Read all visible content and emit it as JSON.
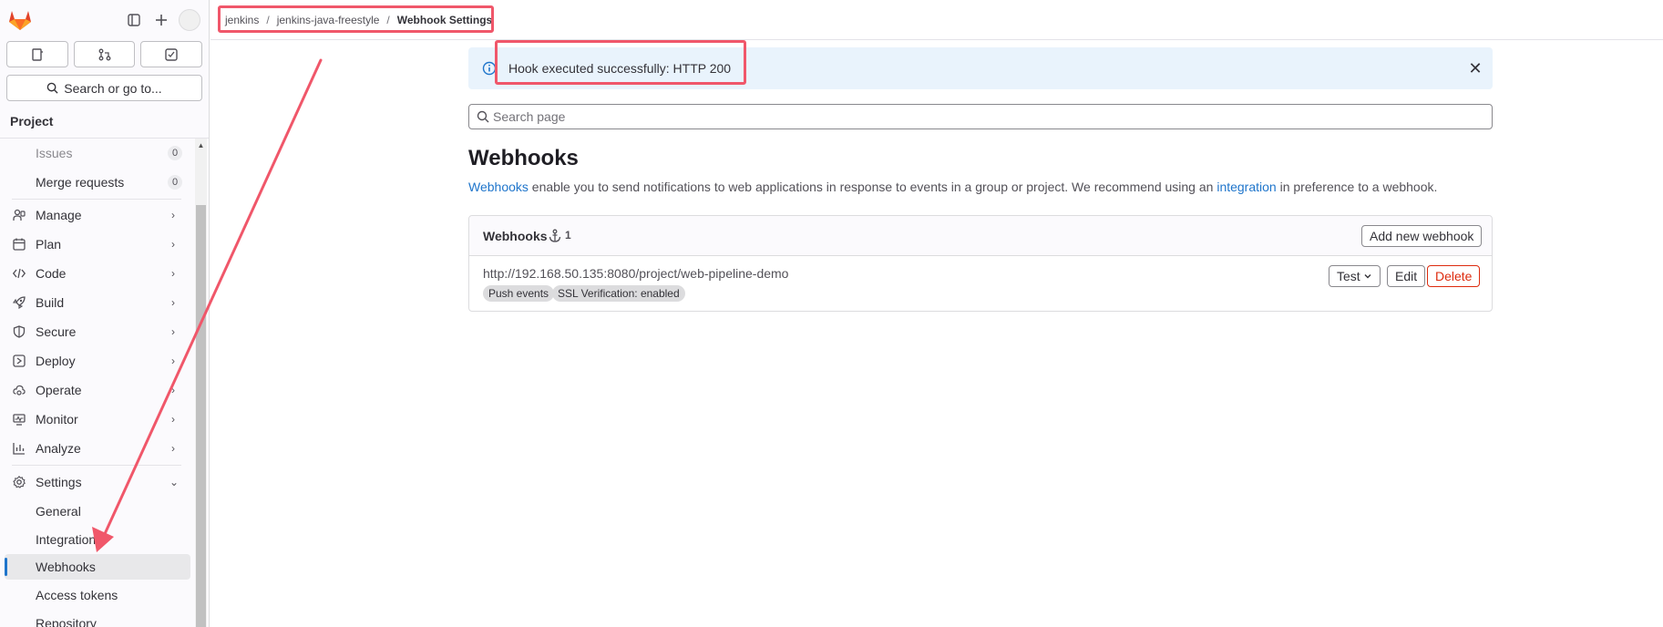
{
  "app": {
    "brand_color": "#fc6d26",
    "accent": "#1f75cb",
    "highlight": "#f0576a"
  },
  "sidebar": {
    "search_label": "Search or go to...",
    "section_title": "Project",
    "items": [
      {
        "label": "Issues",
        "badge": "0",
        "icon": "issues-icon"
      },
      {
        "label": "Merge requests",
        "badge": "0",
        "icon": "merge-request-icon"
      },
      {
        "label": "Manage",
        "icon": "users-icon"
      },
      {
        "label": "Plan",
        "icon": "calendar-icon"
      },
      {
        "label": "Code",
        "icon": "code-icon"
      },
      {
        "label": "Build",
        "icon": "rocket-icon"
      },
      {
        "label": "Secure",
        "icon": "shield-icon"
      },
      {
        "label": "Deploy",
        "icon": "deploy-icon"
      },
      {
        "label": "Operate",
        "icon": "cloud-gear-icon"
      },
      {
        "label": "Monitor",
        "icon": "monitor-icon"
      },
      {
        "label": "Analyze",
        "icon": "chart-icon"
      },
      {
        "label": "Settings",
        "icon": "gear-icon"
      }
    ],
    "settings_sub": [
      "General",
      "Integrations",
      "Webhooks",
      "Access tokens",
      "Repository"
    ]
  },
  "breadcrumb": {
    "items": [
      "jenkins",
      "jenkins-java-freestyle"
    ],
    "current": "Webhook Settings",
    "separator": "/"
  },
  "alert": {
    "message": "Hook executed successfully: HTTP 200",
    "close": "✕"
  },
  "search": {
    "placeholder": "Search page"
  },
  "main": {
    "title": "Webhooks",
    "desc_link1": "Webhooks",
    "desc_mid": " enable you to send notifications to web applications in response to events in a group or project. We recommend using an ",
    "desc_link2": "integration",
    "desc_end": " in preference to a webhook."
  },
  "card": {
    "title": "Webhooks",
    "count": "1",
    "add_button": "Add new webhook",
    "hook": {
      "url": "http://192.168.50.135:8080/project/web-pipeline-demo",
      "tags": [
        "Push events",
        "SSL Verification: enabled"
      ],
      "test_label": "Test",
      "edit_label": "Edit",
      "delete_label": "Delete"
    }
  }
}
